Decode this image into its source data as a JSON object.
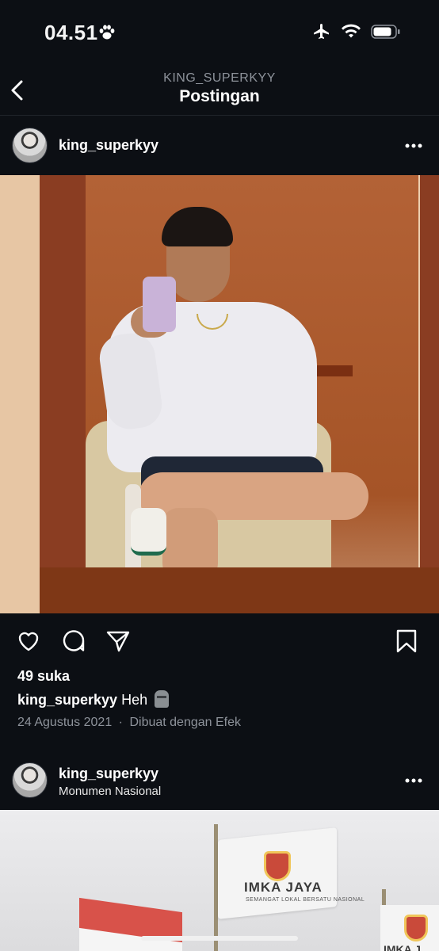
{
  "status_bar": {
    "time": "04.51",
    "icons": [
      "paw-icon",
      "airplane-icon",
      "wifi-icon",
      "battery-icon"
    ]
  },
  "nav": {
    "subtitle": "KING_SUPERKYY",
    "title": "Postingan",
    "back_icon": "chevron-left-icon"
  },
  "posts": [
    {
      "username": "king_superkyy",
      "location": "",
      "likes": "49 suka",
      "caption_user": "king_superkyy",
      "caption_text": "Heh",
      "caption_emoji": "moai-emoji",
      "date": "24 Agustus 2021",
      "separator": "·",
      "effect_note": "Dibuat dengan Efek"
    },
    {
      "username": "king_superkyy",
      "location": "Monumen Nasional"
    }
  ],
  "photo2_text": {
    "flag_title": "IMKA JAYA",
    "flag_subtitle": "SEMANGAT LOKAL BERSATU NASIONAL",
    "flag2_title": "IMKA J"
  },
  "actions": [
    "heart-icon",
    "comment-icon",
    "share-icon",
    "bookmark-icon"
  ],
  "colors": {
    "background": "#0c0f14",
    "text": "#ffffff",
    "muted": "#8e939b"
  }
}
